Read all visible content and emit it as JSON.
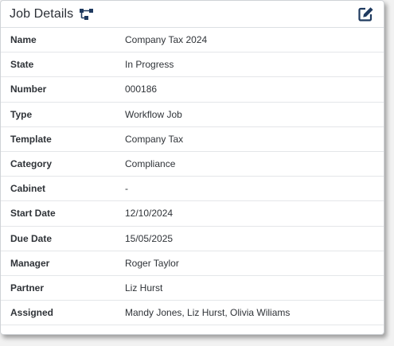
{
  "header": {
    "title": "Job Details",
    "title_icon": "workflow-icon",
    "action_icon": "edit-icon"
  },
  "colors": {
    "icon": "#1f3a5f",
    "text": "#2f3338",
    "divider": "#e4e6e9"
  },
  "details": [
    {
      "label": "Name",
      "value": "Company Tax 2024"
    },
    {
      "label": "State",
      "value": "In Progress"
    },
    {
      "label": "Number",
      "value": "000186"
    },
    {
      "label": "Type",
      "value": "Workflow Job"
    },
    {
      "label": "Template",
      "value": "Company Tax"
    },
    {
      "label": "Category",
      "value": "Compliance"
    },
    {
      "label": "Cabinet",
      "value": "-"
    },
    {
      "label": "Start Date",
      "value": "12/10/2024"
    },
    {
      "label": "Due Date",
      "value": "15/05/2025"
    },
    {
      "label": "Manager",
      "value": "Roger Taylor"
    },
    {
      "label": "Partner",
      "value": "Liz Hurst"
    },
    {
      "label": "Assigned",
      "value": "Mandy Jones, Liz Hurst, Olivia Wiliams"
    }
  ]
}
